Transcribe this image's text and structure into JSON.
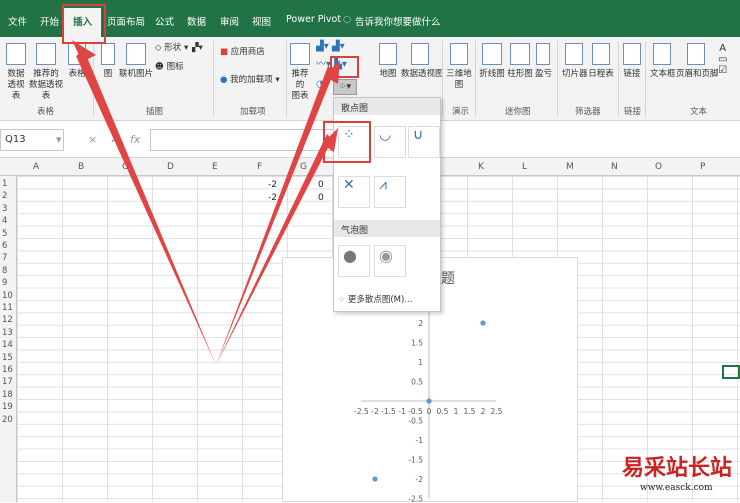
{
  "tabs": [
    "文件",
    "开始",
    "插入",
    "页面布局",
    "公式",
    "数据",
    "审阅",
    "视图",
    "Power Pivot"
  ],
  "tell_me": "告诉我你想要做什么",
  "ribbon": {
    "pivot_table": "数据\n透视表",
    "recommended_pivot": "推荐的\n数据透视表",
    "table": "表格",
    "group_tables": "表格",
    "picture": "图",
    "online_picture": "联机图片",
    "shapes": "形状",
    "icons": "图标",
    "group_illustrations": "插图",
    "store": "应用商店",
    "my_addins": "我的加载项",
    "group_addins": "加载项",
    "recommended_charts": "推荐的\n图表",
    "maps": "地图",
    "pivot_chart": "数据透视图",
    "map3d": "三维地\n图",
    "group_tours": "演示",
    "sparkline_line": "折线图",
    "sparkline_column": "柱形图",
    "sparkline_winloss": "盈亏",
    "group_sparklines": "迷你图",
    "slicer": "切片器",
    "timeline": "日程表",
    "group_filters": "筛选器",
    "link": "链接",
    "group_links": "链接",
    "textbox": "文本框",
    "header_footer": "页眉和页脚",
    "group_text": "文本"
  },
  "formula_bar": {
    "namebox": "Q13",
    "cancel": "×",
    "enter": "✓",
    "fx": "fx"
  },
  "columns": [
    "A",
    "B",
    "C",
    "D",
    "E",
    "F",
    "G",
    "K",
    "L",
    "M",
    "N",
    "O",
    "P"
  ],
  "rows": [
    "1",
    "2",
    "3",
    "4",
    "5",
    "6",
    "7",
    "8",
    "9",
    "10",
    "11",
    "12",
    "13",
    "14",
    "15",
    "16",
    "17",
    "18",
    "19",
    "20"
  ],
  "cells": {
    "f1": "-2",
    "f2": "-2",
    "g1": "0",
    "g2": "0"
  },
  "dropdown": {
    "scatter_header": "散点图",
    "bubble_header": "气泡图",
    "more": "更多散点图(M)..."
  },
  "chart_data": {
    "type": "scatter",
    "title": "题",
    "x": [
      -2,
      0,
      2
    ],
    "y": [
      -2,
      0,
      2
    ],
    "xlim": [
      -2.5,
      2.5
    ],
    "ylim": [
      -2.5,
      2.5
    ],
    "xticks": [
      "-2.5",
      "-2",
      "-1.5",
      "-1",
      "-0.5",
      "0",
      "0.5",
      "1",
      "1.5",
      "2",
      "2.5"
    ],
    "yticks": [
      "2",
      "1.5",
      "1",
      "0.5",
      "0",
      "-0.5",
      "-1",
      "-1.5",
      "-2",
      "-2.5"
    ],
    "color": "#5b9bd5"
  },
  "watermark": {
    "cn": "易采站长站",
    "en": "www.easck.com"
  },
  "colors": {
    "excel_green": "#217346",
    "highlight_red": "#d9413a"
  }
}
